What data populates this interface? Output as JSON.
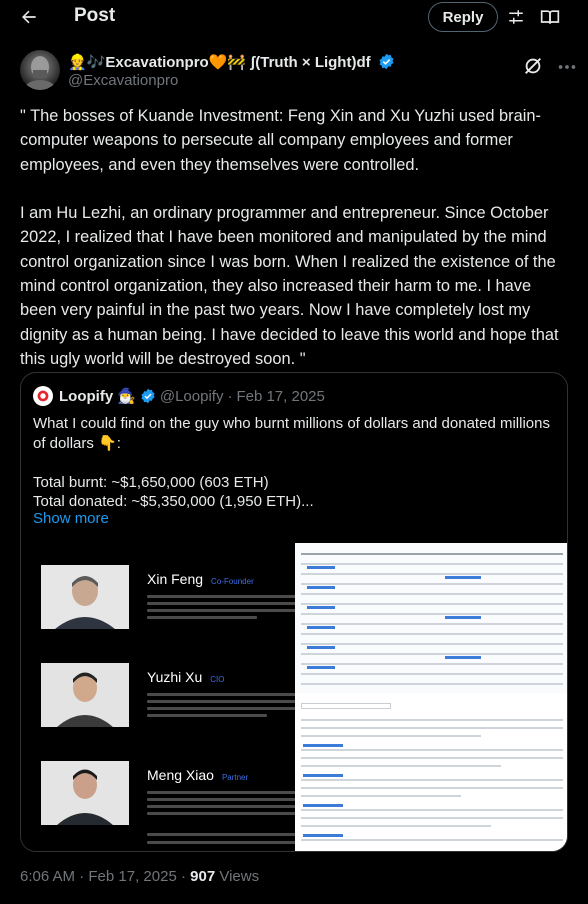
{
  "header": {
    "title": "Post",
    "reply_label": "Reply"
  },
  "author": {
    "display_name": "👷🎶Excavationpro🧡🚧 ʃ(Truth × Light)df",
    "handle": "@Excavationpro",
    "verified": true
  },
  "post": {
    "paragraphs": [
      "\" The bosses of Kuande Investment: Feng Xin and Xu Yuzhi used brain-computer weapons to persecute all company employees and former employees, and even they themselves were controlled.",
      "I am Hu Lezhi, an ordinary programmer and entrepreneur. Since October 2022, I realized that I have been monitored and manipulated by the mind control organization since I was born. When I realized the existence of the mind control organization, they also increased their harm to me. I have been very painful in the past two years. Now I have completely lost my dignity as a human being. I have decided to leave this world and hope that this ugly world will be destroyed soon. \""
    ],
    "time": "6:06 AM",
    "date": "Feb 17, 2025",
    "views_count": "907",
    "views_label": "Views"
  },
  "quote": {
    "name": "Loopify",
    "emoji": "🧙‍♂️",
    "handle": "@Loopify",
    "date": "Feb 17, 2025",
    "text_line": "What I could find on the guy who burnt millions of dollars and donated millions of dollars 👇:",
    "total_burnt": "Total burnt: ~$1,650,000 (603 ETH)",
    "total_donated": "Total donated: ~$5,350,000 (1,950 ETH)...",
    "show_more": "Show more",
    "people": [
      {
        "name": "Xin Feng",
        "role": "Co-Founder"
      },
      {
        "name": "Yuzhi Xu",
        "role": "CIO"
      },
      {
        "name": "Meng Xiao",
        "role": "Partner"
      }
    ]
  },
  "icons": {
    "back": "arrow-left-icon",
    "filter": "sliders-icon",
    "reader": "open-book-icon",
    "grok": "grok-icon",
    "more": "more-icon",
    "verified": "verified-badge-icon"
  },
  "colors": {
    "background": "#000000",
    "text": "#e7e9ea",
    "muted": "#71767b",
    "accent": "#1d9bf0",
    "border": "#2f3336"
  }
}
